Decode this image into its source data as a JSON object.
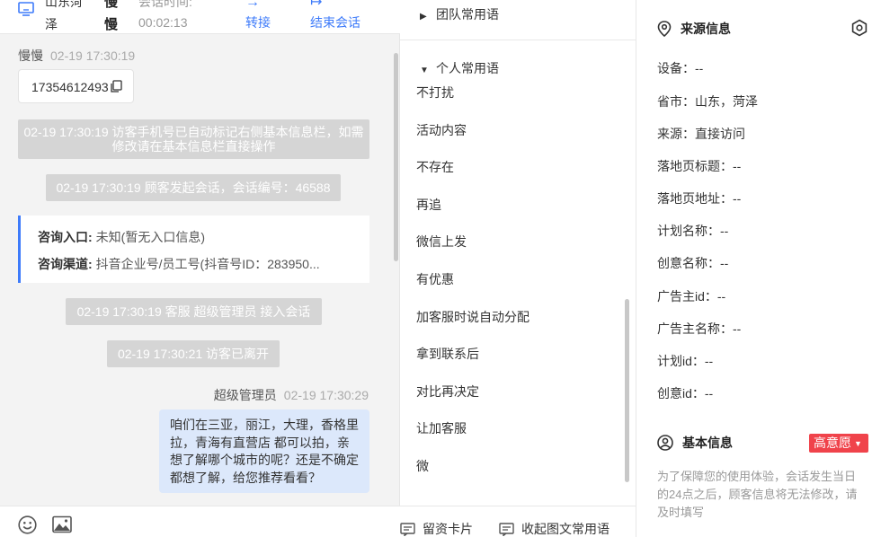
{
  "header": {
    "location": "山东菏泽",
    "visitor_name": "慢慢",
    "session_time_label": "会话时间:",
    "session_time": "00:02:13",
    "transfer_symbol": "→",
    "transfer_label": "转接",
    "end_symbol": "↦",
    "end_label": "结束会话"
  },
  "chat": {
    "visitor_msg": {
      "sender": "慢慢",
      "time": "02-19 17:30:19",
      "text": "17354612493"
    },
    "system_messages": [
      "02-19 17:30:19 访客手机号已自动标记右侧基本信息栏，如需修改请在基本信息栏直接操作",
      "02-19 17:30:19 顾客发起会话，会话编号：46588",
      "02-19 17:30:19 客服 超级管理员 接入会话",
      "02-19 17:30:21 访客已离开"
    ],
    "entry": {
      "label1": "咨询入口:",
      "value1": "未知(暂无入口信息)",
      "label2": "咨询渠道:",
      "value2": "抖音企业号/员工号(抖音号ID：283950..."
    },
    "agent_msg": {
      "sender": "超级管理员",
      "time": "02-19 17:30:29",
      "text": "咱们在三亚，丽江，大理，香格里拉，青海有直营店 都可以拍，亲想了解哪个城市的呢？还是不确定都想了解，给您推荐看看？"
    }
  },
  "phrases": {
    "team_group": "团队常用语",
    "personal_group": "个人常用语",
    "items": [
      "不打扰",
      "活动内容",
      "不存在",
      "再追",
      "微信上发",
      "有优惠",
      "加客服时说自动分配",
      "拿到联系后",
      "对比再决定",
      "让加客服",
      "微"
    ],
    "footer_card": "留资卡片",
    "footer_collapse": "收起图文常用语"
  },
  "info": {
    "source_title": "来源信息",
    "rows": [
      "设备：--",
      "省市：山东，菏泽",
      "来源：直接访问",
      "落地页标题：--",
      "落地页地址：--",
      "计划名称：--",
      "创意名称：--",
      "广告主id：--",
      "广告主名称：--",
      "计划id：--",
      "创意id：--"
    ],
    "basic_title": "基本信息",
    "intent_badge": "高意愿",
    "notice": "为了保障您的使用体验，会话发生当日的24点之后，顾客信息将无法修改，请及时填写"
  },
  "colors": {
    "accent": "#3e7bfa",
    "badge": "#f0434b",
    "agent_bubble": "#dce8fb",
    "system_bg": "#d5d5d5"
  }
}
